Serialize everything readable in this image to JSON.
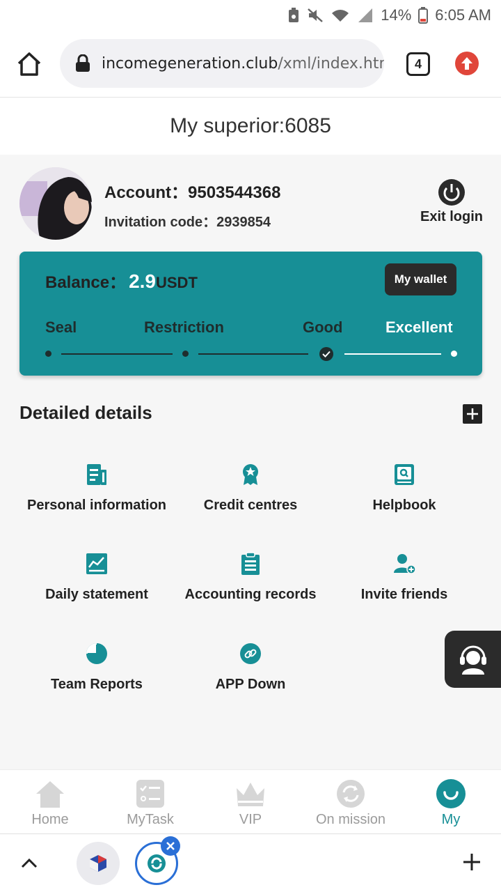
{
  "status_bar": {
    "battery": "14%",
    "time": "6:05 AM"
  },
  "browser": {
    "url_host": "incomegeneration.club",
    "url_path": "/xml/index.html#/",
    "tab_count": "4"
  },
  "header": {
    "superior": "My superior:6085"
  },
  "profile": {
    "account": "Account：9503544368",
    "invitation": "Invitation code：2939854",
    "exit_label": "Exit login"
  },
  "card": {
    "balance_label": "Balance：",
    "balance_value": "2.9",
    "balance_unit": "USDT",
    "wallet_label": "My wallet",
    "levels": [
      "Seal",
      "Restriction",
      "Good",
      "Excellent"
    ]
  },
  "details": {
    "title": "Detailed details",
    "items": [
      {
        "label": "Personal information",
        "icon": "document-icon"
      },
      {
        "label": "Credit centres",
        "icon": "award-icon"
      },
      {
        "label": "Helpbook",
        "icon": "book-icon"
      },
      {
        "label": "Daily statement",
        "icon": "chart-icon"
      },
      {
        "label": "Accounting records",
        "icon": "clipboard-icon"
      },
      {
        "label": "Invite friends",
        "icon": "add-user-icon"
      },
      {
        "label": "Team Reports",
        "icon": "pie-chart-icon"
      },
      {
        "label": "APP Down",
        "icon": "link-icon"
      }
    ]
  },
  "nav": {
    "items": [
      {
        "label": "Home",
        "icon": "home-icon"
      },
      {
        "label": "MyTask",
        "icon": "task-list-icon"
      },
      {
        "label": "VIP",
        "icon": "crown-icon"
      },
      {
        "label": "On mission",
        "icon": "refresh-icon"
      },
      {
        "label": "My",
        "icon": "my-icon"
      }
    ],
    "active": "My"
  },
  "colors": {
    "accent": "#178f96",
    "dark": "#2b2b2b",
    "inactive": "#9b9b9b"
  }
}
